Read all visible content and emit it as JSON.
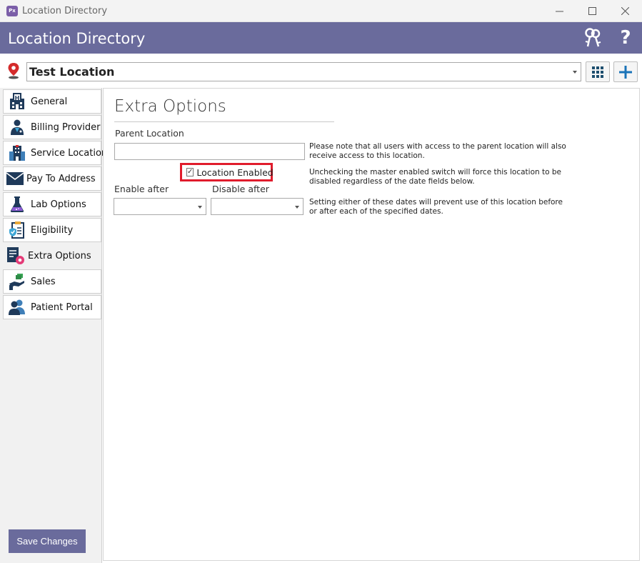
{
  "window": {
    "title": "Location Directory",
    "app_icon_text": "Px"
  },
  "header": {
    "title": "Location Directory",
    "help_glyph": "?"
  },
  "location": {
    "selected": "Test Location"
  },
  "sidebar": {
    "items": [
      {
        "label": "General",
        "icon": "hospital-icon"
      },
      {
        "label": "Billing Provider",
        "icon": "doctor-icon"
      },
      {
        "label": "Service Location",
        "icon": "building-icon"
      },
      {
        "label": "Pay To Address",
        "icon": "envelope-icon"
      },
      {
        "label": "Lab Options",
        "icon": "flask-icon"
      },
      {
        "label": "Eligibility",
        "icon": "checklist-shield-icon"
      },
      {
        "label": "Extra Options",
        "icon": "document-gear-icon",
        "active": true
      },
      {
        "label": "Sales",
        "icon": "sales-hand-icon"
      },
      {
        "label": "Patient Portal",
        "icon": "users-icon"
      }
    ],
    "save_label": "Save Changes"
  },
  "extra_options": {
    "title": "Extra Options",
    "parent_location_label": "Parent Location",
    "parent_location_value": "",
    "parent_note": "Please note that all users with access to the parent location will also receive access to this location.",
    "location_enabled_label": "Location Enabled",
    "location_enabled_checked": true,
    "check_glyph": "✓",
    "enabled_note": "Unchecking the master enabled switch will force this location to be disabled regardless of the date fields below.",
    "enable_after_label": "Enable after",
    "disable_after_label": "Disable after",
    "enable_after_value": "",
    "disable_after_value": "",
    "dates_note": "Setting either of these dates will prevent use of this location before or after each of the specified dates."
  }
}
